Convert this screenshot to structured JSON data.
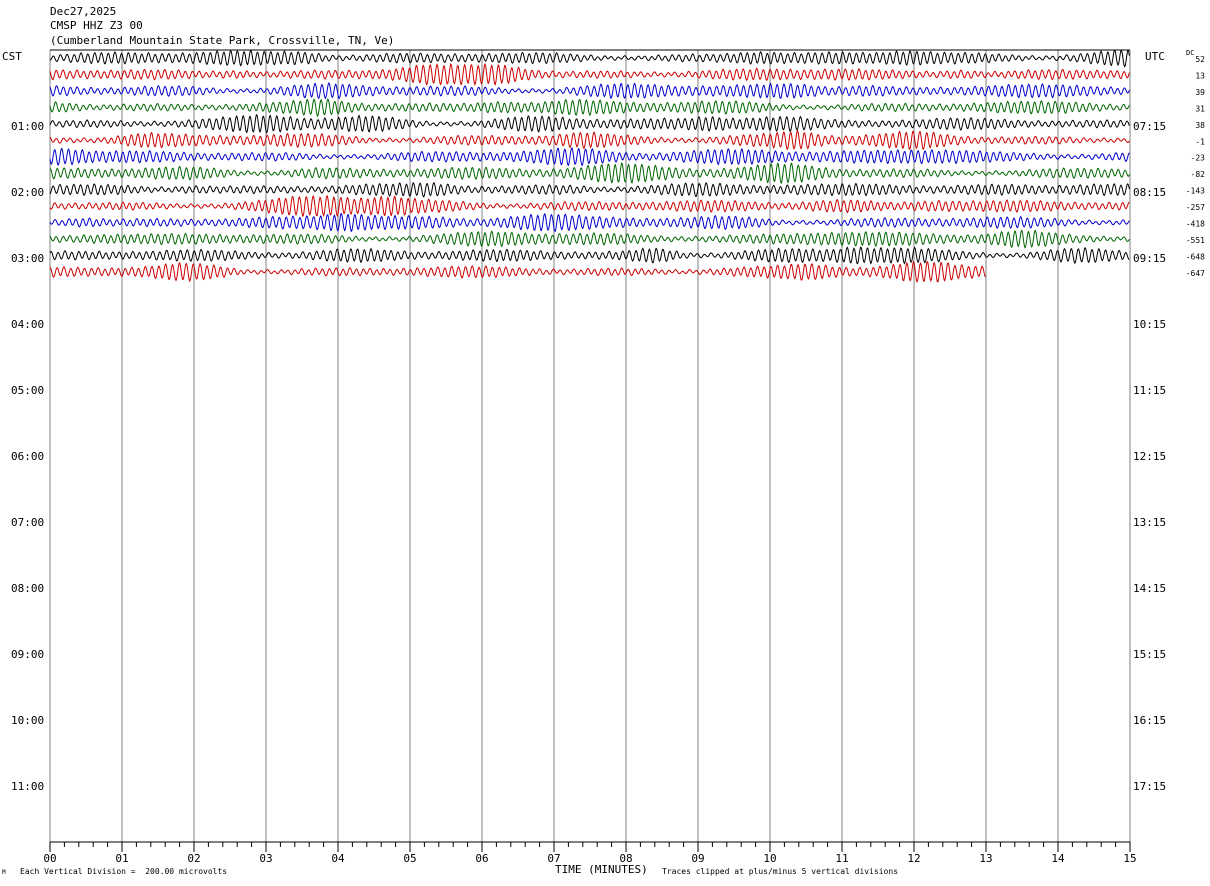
{
  "header": {
    "date": "Dec27,2025",
    "station": "CMSP HHZ Z3 00",
    "location": "(Cumberland Mountain State Park, Crossville, TN, Ve)"
  },
  "left_tz": "CST",
  "right_tz": "UTC",
  "dc_label": "DC",
  "footer": {
    "scale_note": "Each Vertical Division =  200.00 microvolts",
    "clip_note": "Traces clipped at plus/minus 5 vertical divisions",
    "corner_mark": "M"
  },
  "chart_data": {
    "type": "line",
    "title": "",
    "xlabel": "TIME (MINUTES)",
    "ylabel": "",
    "xlim": [
      0,
      15
    ],
    "x_ticks": [
      "00",
      "01",
      "02",
      "03",
      "04",
      "05",
      "06",
      "07",
      "08",
      "09",
      "10",
      "11",
      "12",
      "13",
      "14",
      "15"
    ],
    "hour_labels_local": [
      "01:00",
      "02:00",
      "03:00",
      "04:00",
      "05:00",
      "06:00",
      "07:00",
      "08:00",
      "09:00",
      "10:00",
      "11:00"
    ],
    "hour_labels_utc": [
      "07:15",
      "08:15",
      "09:15",
      "10:15",
      "11:15",
      "12:15",
      "13:15",
      "14:15",
      "15:15",
      "16:15",
      "17:15"
    ],
    "trace_colors": [
      "#000000",
      "#cc0000",
      "#0000cc",
      "#006600"
    ],
    "trace_count": 14,
    "dc_offsets": [
      "52",
      "13",
      "39",
      "31",
      "38",
      "-1",
      "-23",
      "-82",
      "-143",
      "-257",
      "-418",
      "-551",
      "-648",
      "-647"
    ],
    "last_trace_end_minute": 13
  }
}
